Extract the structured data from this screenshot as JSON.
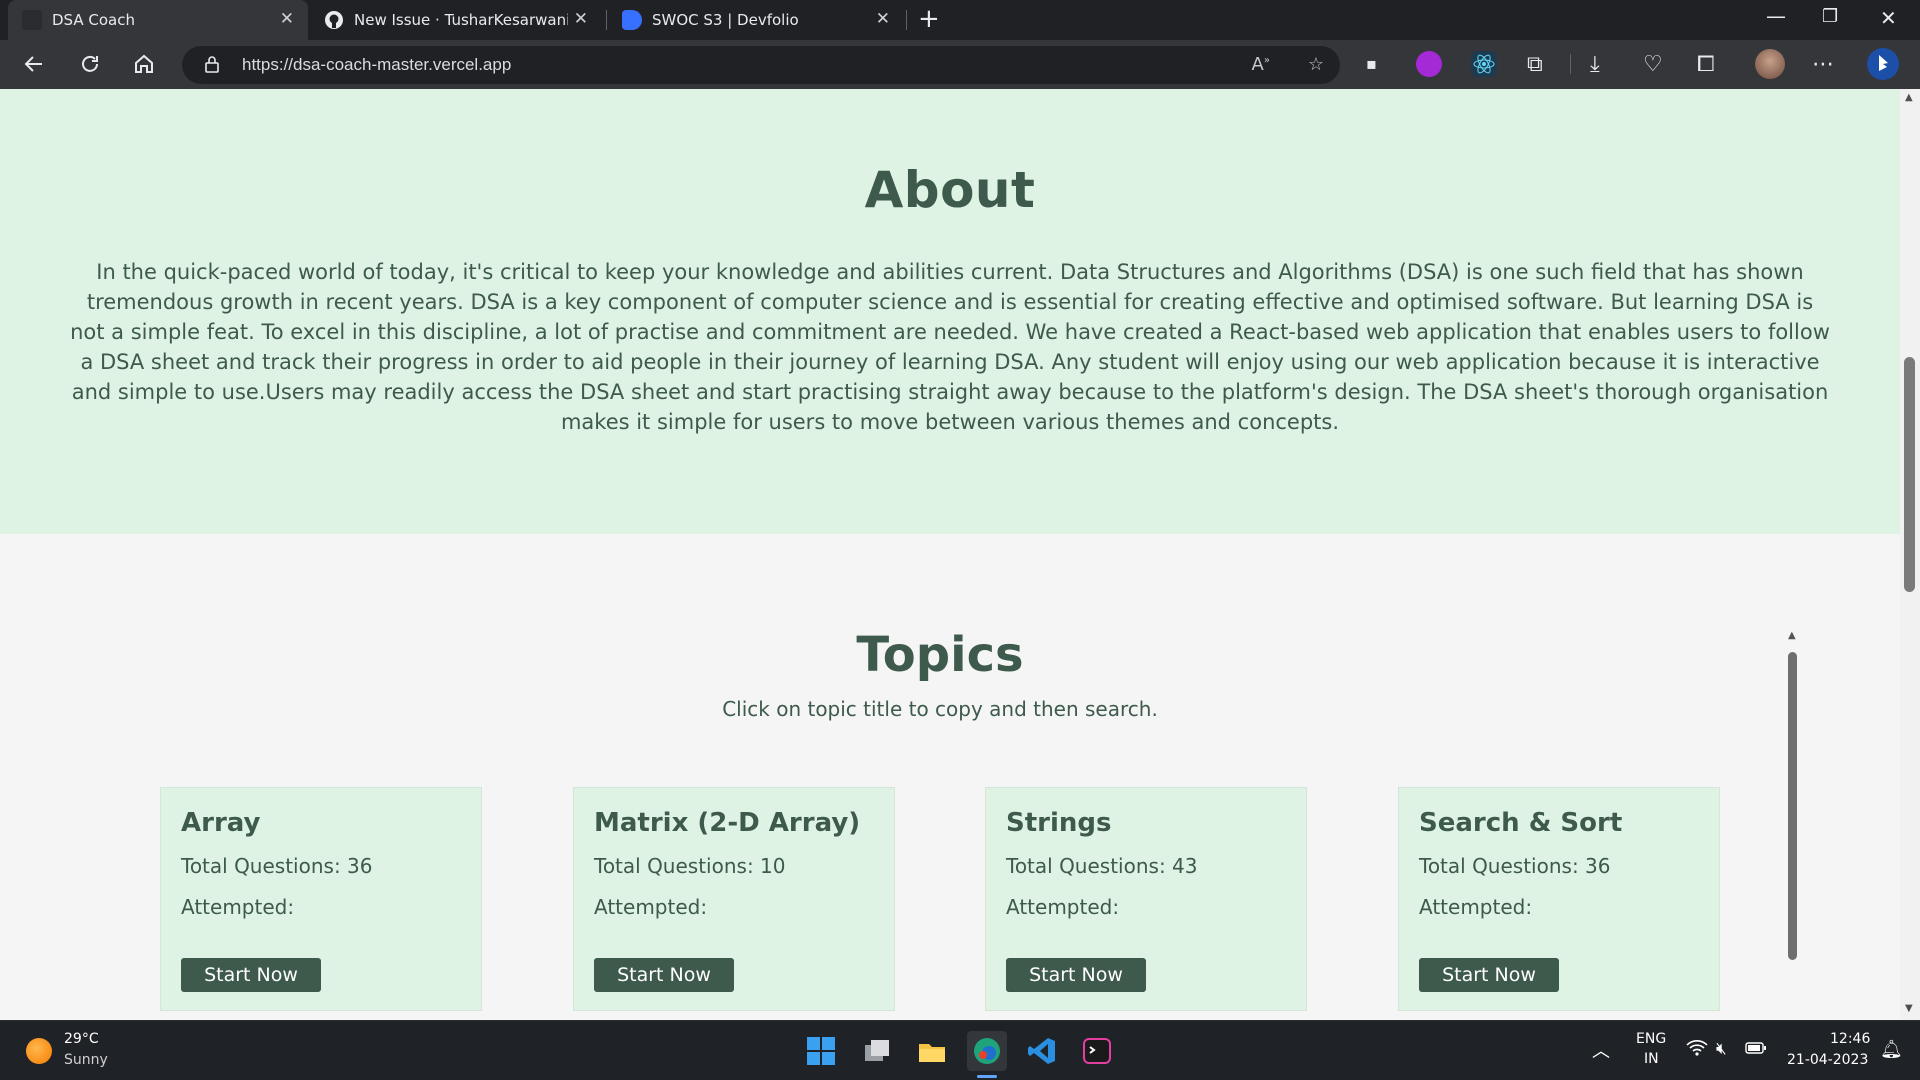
{
  "browser": {
    "tabs": [
      {
        "title": "DSA Coach",
        "active": true
      },
      {
        "title": "New Issue · TusharKesarwani/Fro",
        "active": false
      },
      {
        "title": "SWOC S3 | Devfolio",
        "active": false
      }
    ],
    "new_tab_symbol": "+",
    "url": "https://dsa-coach-master.vercel.app",
    "close_symbol": "✕"
  },
  "about": {
    "title": "About",
    "text": "In the quick-paced world of today, it's critical to keep your knowledge and abilities current. Data Structures and Algorithms (DSA) is one such field that has shown tremendous growth in recent years. DSA is a key component of computer science and is essential for creating effective and optimised software. But learning DSA is not a simple feat. To excel in this discipline, a lot of practise and commitment are needed. We have created a React-based web application that enables users to follow a DSA sheet and track their progress in order to aid people in their journey of learning DSA. Any student will enjoy using our web application because it is interactive and simple to use.Users may readily access the DSA sheet and start practising straight away because to the platform's design. The DSA sheet's thorough organisation makes it simple for users to move between various themes and concepts."
  },
  "topics": {
    "title": "Topics",
    "subtitle": "Click on topic title to copy and then search.",
    "cards": [
      {
        "title": "Array",
        "total": "Total Questions: 36",
        "attempted": "Attempted:",
        "button": "Start Now"
      },
      {
        "title": "Matrix (2-D Array)",
        "total": "Total Questions: 10",
        "attempted": "Attempted:",
        "button": "Start Now"
      },
      {
        "title": "Strings",
        "total": "Total Questions: 43",
        "attempted": "Attempted:",
        "button": "Start Now"
      },
      {
        "title": "Search & Sort",
        "total": "Total Questions: 36",
        "attempted": "Attempted:",
        "button": "Start Now"
      }
    ]
  },
  "taskbar": {
    "weather_temp": "29°C",
    "weather_cond": "Sunny",
    "lang_1": "ENG",
    "lang_2": "IN",
    "time": "12:46",
    "date": "21-04-2023"
  },
  "colors": {
    "accent": "#3d5a4c",
    "about_bg": "#dff3e4",
    "page_bg": "#f5f5f5"
  }
}
